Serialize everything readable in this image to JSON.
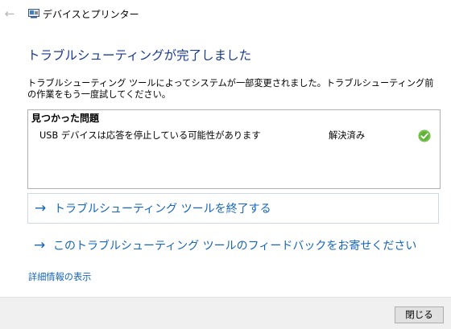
{
  "window": {
    "title": "デバイスとプリンター",
    "back_icon": "back-arrow-icon",
    "app_icon": "devices-printers-icon"
  },
  "heading": "トラブルシューティングが完了しました",
  "description": "トラブルシューティング ツールによってシステムが一部変更されました。トラブルシューティング前の作業をもう一度試してください。",
  "problems": {
    "header": "見つかった問題",
    "items": [
      {
        "text": "USB デバイスは応答を停止している可能性があります",
        "status": "解決済み",
        "status_icon": "check-circle-icon"
      }
    ]
  },
  "links": {
    "close_troubleshooter": "トラブルシューティング ツールを終了する",
    "feedback": "このトラブルシューティング ツールのフィードバックをお寄せください",
    "details": "詳細情報の表示"
  },
  "footer": {
    "close_label": "閉じる"
  },
  "colors": {
    "heading": "#1a3a8a",
    "link": "#1565b8",
    "success": "#5fb236",
    "footer_bg": "#f0f0f0"
  }
}
